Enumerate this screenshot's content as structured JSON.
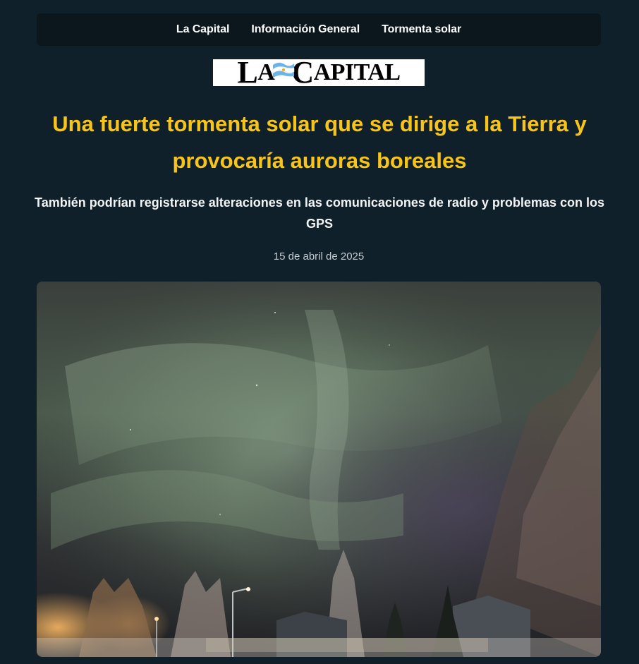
{
  "nav": {
    "items": [
      {
        "label": "La Capital"
      },
      {
        "label": "Información General"
      },
      {
        "label": "Tormenta solar"
      }
    ]
  },
  "logo": {
    "text": "LA CAPITAL"
  },
  "article": {
    "headline": "Una fuerte tormenta solar que se dirige a la Tierra y provocaría auroras boreales",
    "subheadline": "También podrían registrarse alteraciones en las comunicaciones de radio y problemas con los GPS",
    "date": "15 de abril de 2025"
  },
  "colors": {
    "background": "#10202a",
    "nav_background": "#0b161d",
    "headline": "#f7c51a",
    "subheadline": "#f2f4f5",
    "date": "#c5cdd2"
  }
}
